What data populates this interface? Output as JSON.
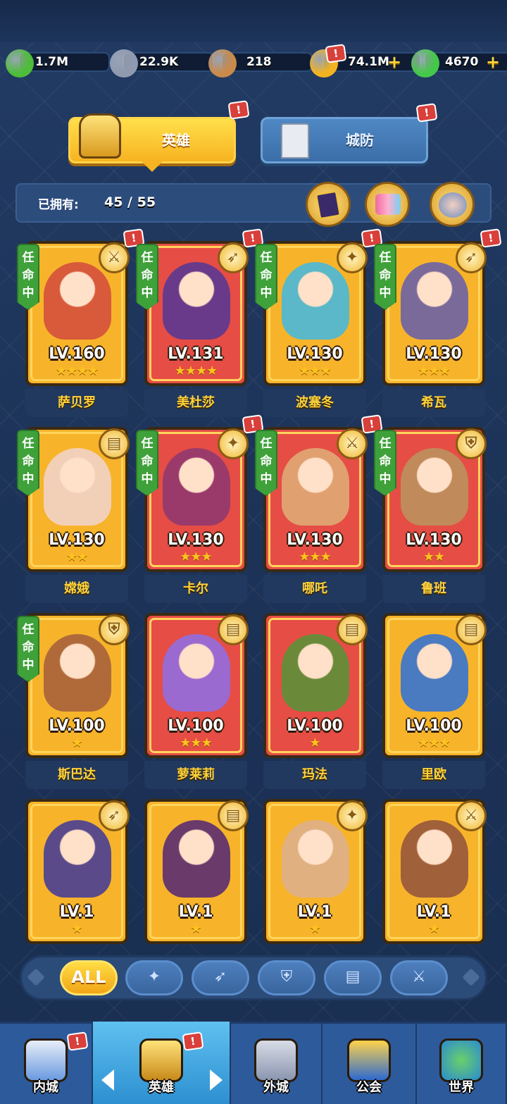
{
  "resources": [
    {
      "name": "exp",
      "icon": "exp-icon",
      "value": "1.7M",
      "color": "#4dbd3a"
    },
    {
      "name": "stone",
      "icon": "stone-icon",
      "value": "22.9K",
      "color": "#8f9ab0"
    },
    {
      "name": "hammer",
      "icon": "hammer-icon",
      "value": "218",
      "color": "#c98a4a"
    },
    {
      "name": "gold",
      "icon": "gold-coin-icon",
      "value": "74.1M",
      "color": "#f3b321"
    },
    {
      "name": "gems",
      "icon": "gem-icon",
      "value": "4670",
      "color": "#45c84a"
    }
  ],
  "tabs": {
    "heroes": "英雄",
    "defense": "城防"
  },
  "owned": {
    "label": "已拥有:",
    "count": "45 / 55"
  },
  "assign_label": "任命中",
  "heroes": [
    {
      "name": "萨贝罗",
      "level": "LV.160",
      "stars": "★★★★",
      "role": "sword-icon",
      "bg": "gold",
      "assigned": true,
      "alert": true,
      "color": "#d85a3a"
    },
    {
      "name": "美杜莎",
      "level": "LV.131",
      "stars": "★★★★",
      "role": "bow-icon",
      "bg": "red",
      "assigned": true,
      "alert": true,
      "color": "#6a3a8a"
    },
    {
      "name": "波塞冬",
      "level": "LV.130",
      "stars": "★★★",
      "role": "staff-icon",
      "bg": "gold",
      "assigned": true,
      "alert": true,
      "color": "#5ab8c8"
    },
    {
      "name": "希瓦",
      "level": "LV.130",
      "stars": "★★★",
      "role": "bow-icon",
      "bg": "gold",
      "assigned": true,
      "alert": true,
      "color": "#7a6a9a"
    },
    {
      "name": "嫦娥",
      "level": "LV.130",
      "stars": "★★",
      "role": "book-icon",
      "bg": "gold",
      "assigned": true,
      "alert": false,
      "color": "#f2d0b8"
    },
    {
      "name": "卡尔",
      "level": "LV.130",
      "stars": "★★★",
      "role": "staff-icon",
      "bg": "red",
      "assigned": true,
      "alert": true,
      "color": "#9a3a6a"
    },
    {
      "name": "哪吒",
      "level": "LV.130",
      "stars": "★★★",
      "role": "sword-icon",
      "bg": "red",
      "assigned": true,
      "alert": true,
      "color": "#e0a070"
    },
    {
      "name": "鲁班",
      "level": "LV.130",
      "stars": "★★",
      "role": "shield-icon",
      "bg": "red",
      "assigned": true,
      "alert": false,
      "color": "#c08a5a"
    },
    {
      "name": "斯巴达",
      "level": "LV.100",
      "stars": "★",
      "role": "shield-icon",
      "bg": "gold",
      "assigned": true,
      "alert": false,
      "color": "#b06a3a"
    },
    {
      "name": "萝莱莉",
      "level": "LV.100",
      "stars": "★★★",
      "role": "book-icon",
      "bg": "red",
      "assigned": false,
      "alert": false,
      "color": "#9a6ad0"
    },
    {
      "name": "玛法",
      "level": "LV.100",
      "stars": "★",
      "role": "book-icon",
      "bg": "red",
      "assigned": false,
      "alert": false,
      "color": "#6a8a3a"
    },
    {
      "name": "里欧",
      "level": "LV.100",
      "stars": "★★★",
      "role": "book-icon",
      "bg": "gold",
      "assigned": false,
      "alert": false,
      "color": "#4a7ac0"
    },
    {
      "name": "",
      "level": "LV.1",
      "stars": "★",
      "role": "bow-icon",
      "bg": "gold",
      "assigned": false,
      "alert": false,
      "color": "#5a4a8a"
    },
    {
      "name": "",
      "level": "LV.1",
      "stars": "★",
      "role": "book-icon",
      "bg": "gold",
      "assigned": false,
      "alert": false,
      "color": "#6a3a6a"
    },
    {
      "name": "",
      "level": "LV.1",
      "stars": "★",
      "role": "staff-icon",
      "bg": "gold",
      "assigned": false,
      "alert": false,
      "color": "#e0b080"
    },
    {
      "name": "",
      "level": "LV.1",
      "stars": "★",
      "role": "sword-icon",
      "bg": "gold",
      "assigned": false,
      "alert": false,
      "color": "#a0603a"
    }
  ],
  "filters": [
    {
      "name": "all",
      "label": "ALL"
    },
    {
      "name": "staff",
      "icon": "staff-icon"
    },
    {
      "name": "bow",
      "icon": "bow-icon"
    },
    {
      "name": "shield",
      "icon": "shield-icon"
    },
    {
      "name": "book",
      "icon": "book-icon"
    },
    {
      "name": "sword",
      "icon": "sword-icon"
    }
  ],
  "nav": [
    {
      "name": "inner-city",
      "label": "内城",
      "icon": "castle-icon",
      "alert": true
    },
    {
      "name": "heroes",
      "label": "英雄",
      "icon": "helmet-icon",
      "alert": true,
      "active": true
    },
    {
      "name": "outer-city",
      "label": "外城",
      "icon": "tower-icon",
      "alert": false
    },
    {
      "name": "guild",
      "label": "公会",
      "icon": "handshake-icon",
      "alert": false
    },
    {
      "name": "world",
      "label": "世界",
      "icon": "globe-icon",
      "alert": false
    }
  ],
  "alert_mark": "!"
}
